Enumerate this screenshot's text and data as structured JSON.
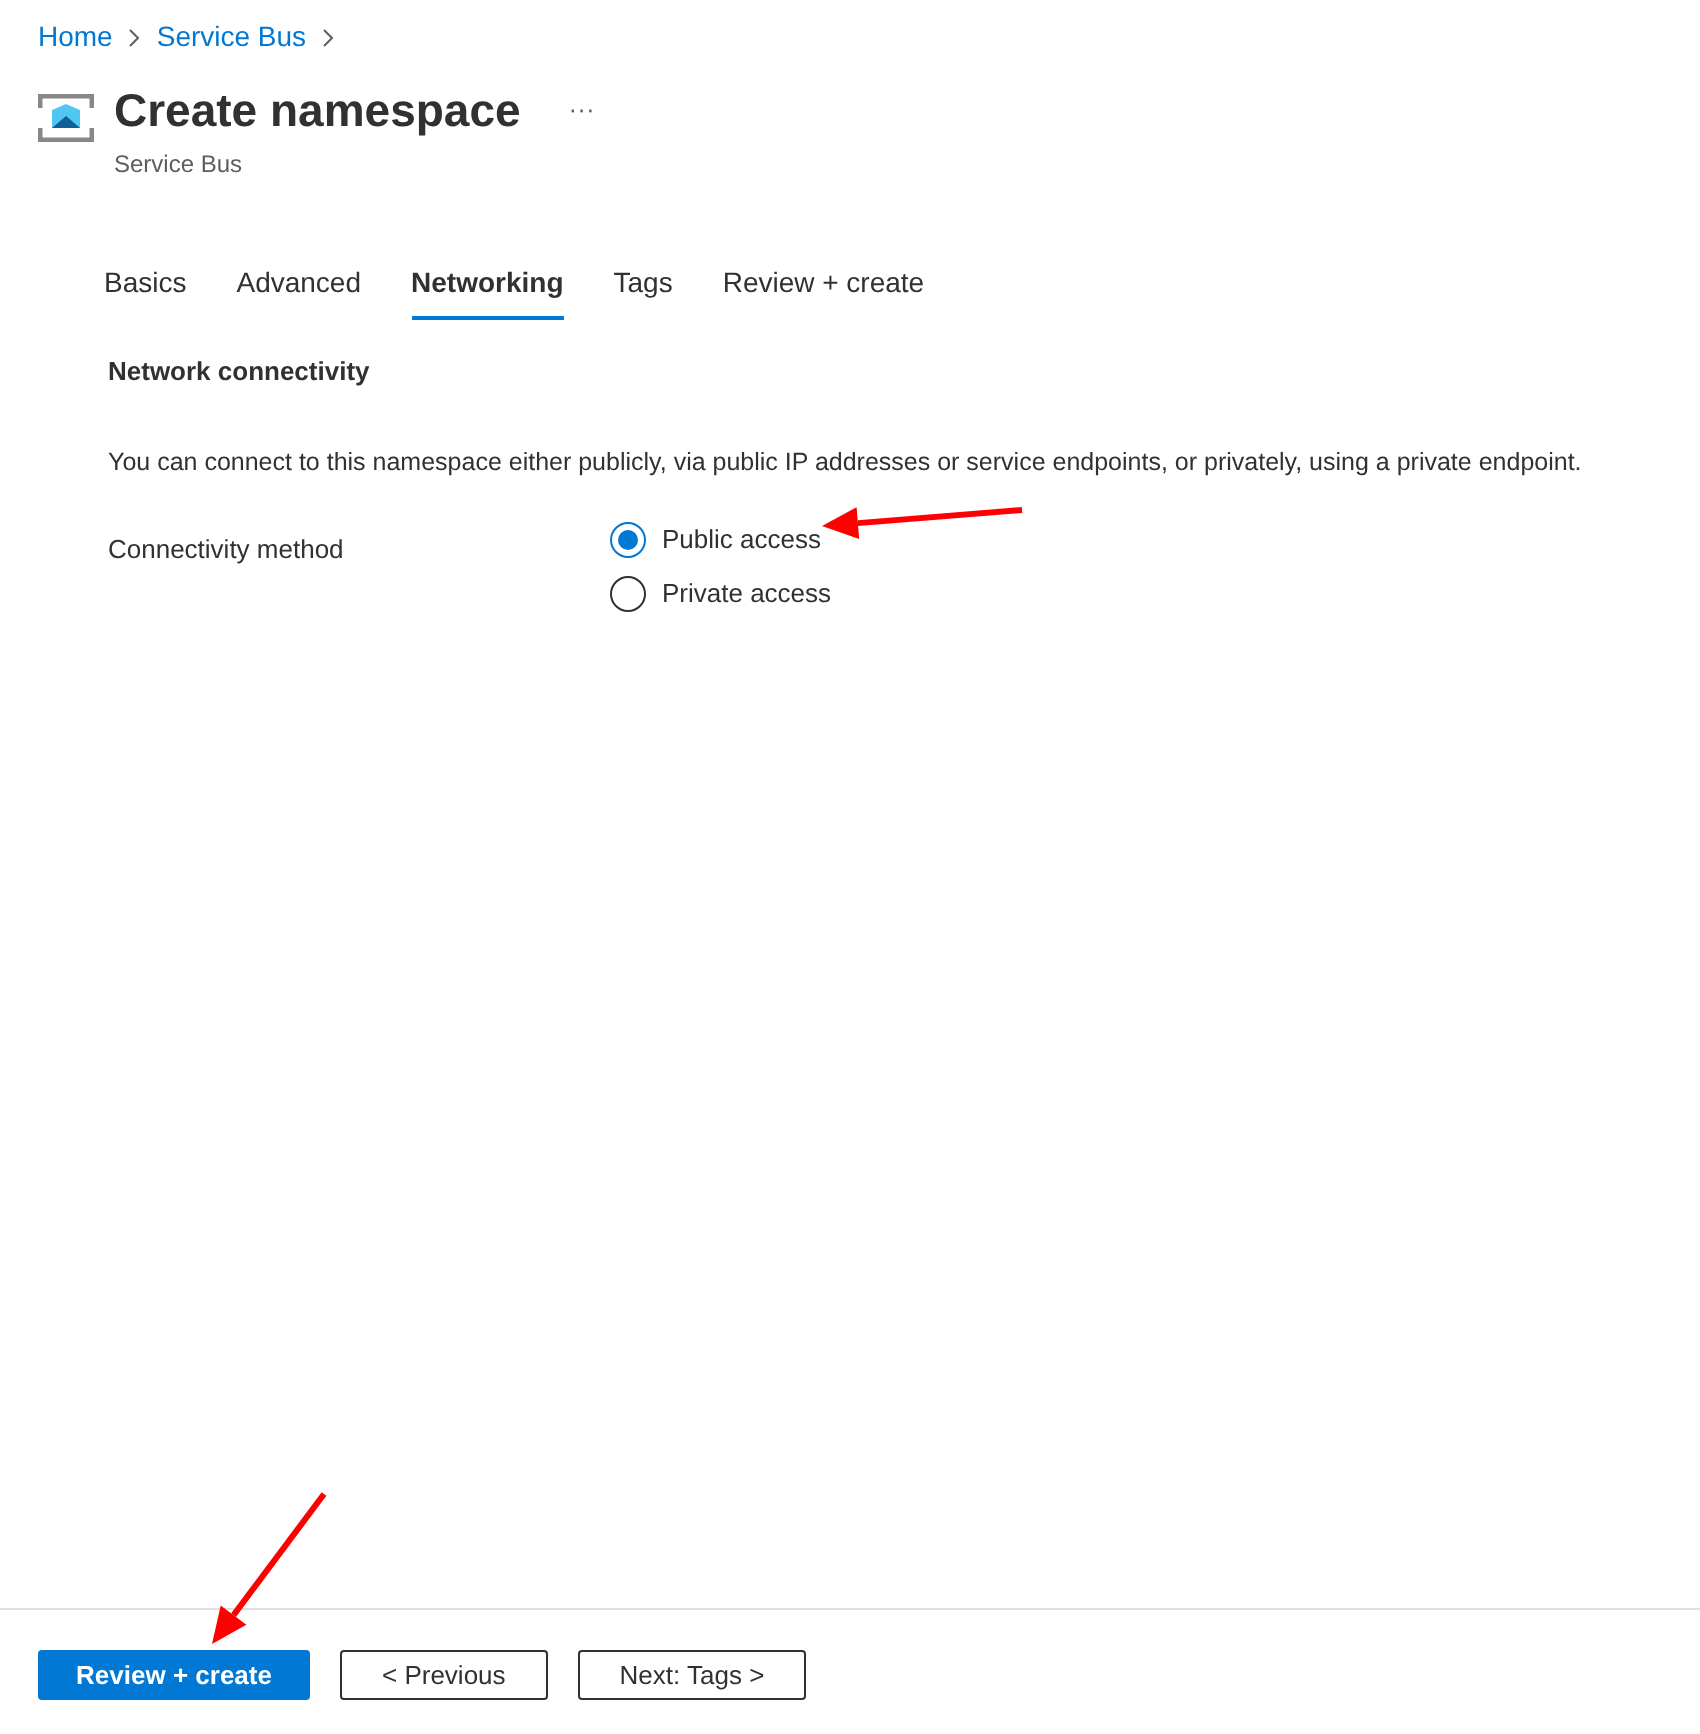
{
  "breadcrumb": [
    {
      "label": "Home"
    },
    {
      "label": "Service Bus"
    }
  ],
  "header": {
    "title": "Create namespace",
    "more": "···",
    "subtitle": "Service Bus"
  },
  "tabs": [
    {
      "label": "Basics",
      "selected": false
    },
    {
      "label": "Advanced",
      "selected": false
    },
    {
      "label": "Networking",
      "selected": true
    },
    {
      "label": "Tags",
      "selected": false
    },
    {
      "label": "Review + create",
      "selected": false
    }
  ],
  "section": {
    "heading": "Network connectivity",
    "description": "You can connect to this namespace either publicly, via public IP addresses or service endpoints, or privately, using a private endpoint.",
    "field_label": "Connectivity method",
    "options": [
      {
        "label": "Public access",
        "selected": true
      },
      {
        "label": "Private access",
        "selected": false
      }
    ]
  },
  "buttons": [
    {
      "label": "Review + create",
      "kind": "primary"
    },
    {
      "label": "< Previous",
      "kind": "secondary"
    },
    {
      "label": "Next: Tags >",
      "kind": "secondary"
    }
  ]
}
